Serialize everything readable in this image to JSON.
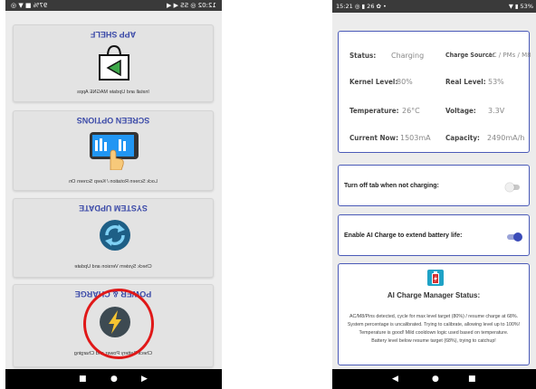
{
  "left_phone": {
    "status_left": "97% ■ ▼ ◎",
    "status_right": "12:02 ◎ SS ◀ ◀",
    "cards": [
      {
        "title": "APP SHELF",
        "desc": "Install and Update MAGNE Apps",
        "icon": "shelf-bag-icon"
      },
      {
        "title": "SCREEN OPTIONS",
        "desc": "Lock Screen Rotation / Keep Screen On",
        "icon": "tablet-touch-icon"
      },
      {
        "title": "SYSTEM UPDATE",
        "desc": "Check System Version and Update",
        "icon": "refresh-icon"
      },
      {
        "title": "POWER & CHARGE",
        "desc": "Check Battery Power and Charging",
        "icon": "lightning-bolt-icon"
      }
    ],
    "nav": {
      "recents": "■",
      "home": "●",
      "back": "▶"
    }
  },
  "right_phone": {
    "status_left": "15:21 ◎ ▮ 26 ✿ •",
    "status_right": "▼ ▮ 53%",
    "battery": {
      "status_label": "Status:",
      "status_value": "Charging",
      "source_label": "Charge Source:",
      "source_value": "AC / PMs / M8",
      "kernel_label": "Kernel Level:",
      "kernel_value": "80%",
      "real_label": "Real Level:",
      "real_value": "53%",
      "temp_label": "Temperature:",
      "temp_value": "26°C",
      "voltage_label": "Voltage:",
      "voltage_value": "3.3V",
      "current_label": "Current Now:",
      "current_value": "1503mA",
      "capacity_label": "Capacity:",
      "capacity_value": "2490mA/h"
    },
    "toggle1": {
      "label": "Turn off tab when not charging:",
      "on": false
    },
    "toggle2": {
      "label": "Enable AI Charge to extend battery life:",
      "on": true
    },
    "ai": {
      "title": "AI Charge Manager Status:",
      "lines": [
        "AC/M8/Pins detected, cycle for max level target (80%) / resume charge at 68%.",
        "System percentage is uncalibrated. Trying to calibrate, allowing level up to 100%!",
        "Temperature is good! Mild cooldown logic used based on temperature.",
        "Battery level below resume target (68%), trying to catchup!"
      ]
    },
    "nav": {
      "back": "◀",
      "home": "●",
      "recents": "■"
    }
  },
  "colors": {
    "accent": "#3a4bb8",
    "title_blue": "#3b4aa8",
    "highlight_red": "#e01818",
    "battery_red": "#d32f2f",
    "battery_bg": "#1fa2c6"
  }
}
